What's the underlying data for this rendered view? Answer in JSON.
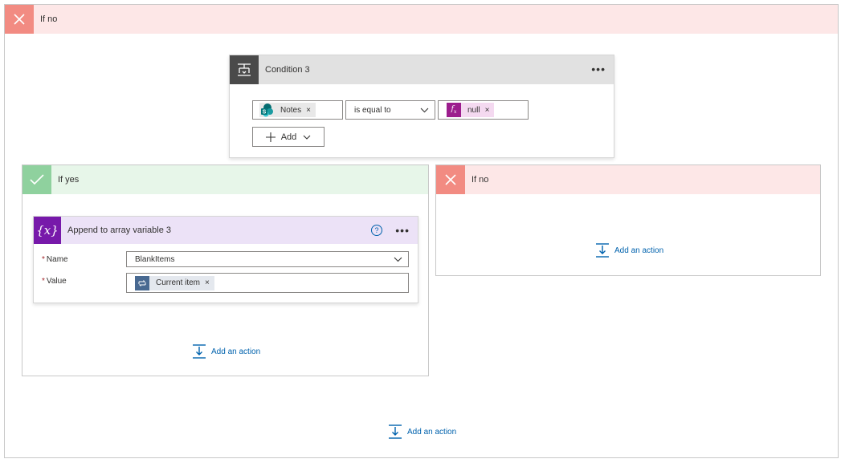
{
  "outer": {
    "header_label": "If no"
  },
  "condition": {
    "title": "Condition 3",
    "left_operand": "Notes",
    "operator": "is equal to",
    "right_operand": "null",
    "add_label": "Add"
  },
  "yes_branch": {
    "header_label": "If yes",
    "action": {
      "title": "Append to array variable 3",
      "name_label": "Name",
      "name_value": "BlankItems",
      "value_label": "Value",
      "value_token": "Current item",
      "required_marker": "*"
    },
    "add_action_label": "Add an action"
  },
  "no_branch": {
    "header_label": "If no",
    "add_action_label": "Add an action"
  },
  "bottom": {
    "add_action_label": "Add an action"
  },
  "icons": {
    "close": "close-icon",
    "check": "check-icon",
    "condition": "condition-icon",
    "sharepoint": "sharepoint-icon",
    "expression": "fx-icon",
    "variable": "variable-icon",
    "help": "help-icon",
    "more": "more-icon",
    "add_action": "add-action-icon",
    "loop": "loop-icon",
    "chevron": "chevron-down-icon",
    "plus": "plus-icon"
  },
  "colors": {
    "no_header_bg": "#fde7e7",
    "no_icon_bg": "#f28b82",
    "yes_header_bg": "#e7f6e9",
    "yes_icon_bg": "#8fd19e",
    "variable_accent": "#7719aa",
    "expression_accent": "#9c1d8d",
    "link": "#0062ad"
  }
}
